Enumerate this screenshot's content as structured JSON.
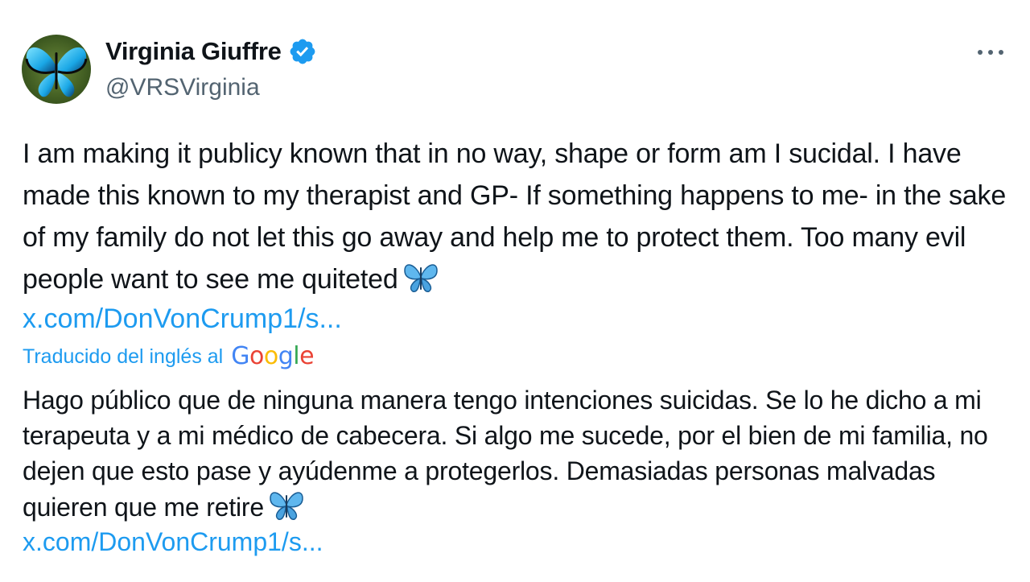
{
  "author": {
    "display_name": "Virginia Giuffre",
    "handle": "@VRSVirginia",
    "verified_icon": "verified-badge-icon",
    "avatar_icon": "butterfly-avatar"
  },
  "menu": {
    "icon": "more-horizontal-icon"
  },
  "tweet": {
    "text": "I am making it publicy known that in no way, shape or form am I sucidal. I have made this known to my therapist and GP- If something happens to me- in the sake of my family do not let this go away and help me to protect them. Too many evil people want to see me quiteted",
    "emoji": "butterfly-emoji",
    "link": "x.com/DonVonCrump1/s..."
  },
  "translation": {
    "label": "Traducido del inglés al",
    "provider": "Google",
    "text": "Hago público que de ninguna manera tengo intenciones suicidas. Se lo he dicho a mi terapeuta y a mi médico de cabecera. Si algo me sucede, por el bien de mi familia, no dejen que esto pase y ayúdenme a protegerlos. Demasiadas personas malvadas quieren que me retire",
    "emoji": "butterfly-emoji",
    "link": "x.com/DonVonCrump1/s..."
  },
  "colors": {
    "link": "#1d9bf0",
    "text": "#0f1419",
    "secondary": "#536471",
    "verified": "#1d9bf0"
  }
}
